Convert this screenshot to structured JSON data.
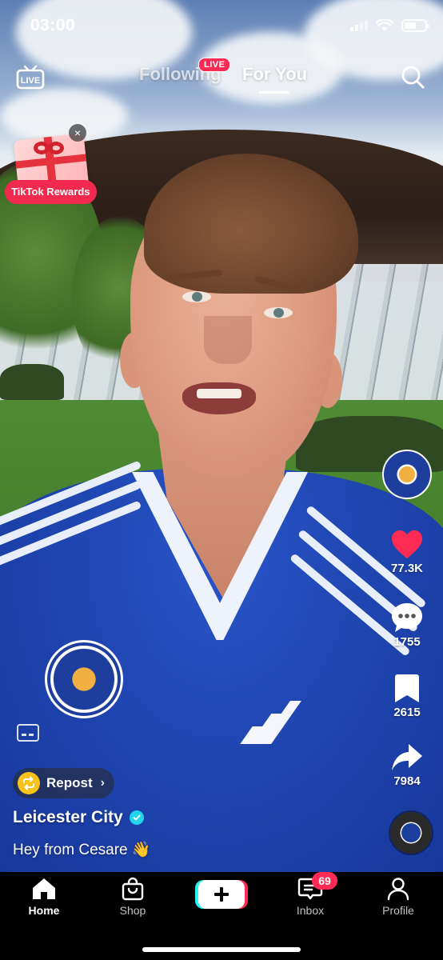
{
  "status_bar": {
    "time": "03:00"
  },
  "top_nav": {
    "tabs": [
      {
        "label": "Following",
        "active": false
      },
      {
        "label": "For You",
        "active": true
      }
    ],
    "live_badge": "LIVE",
    "live_icon_label": "LIVE"
  },
  "rewards": {
    "label": "TikTok Rewards",
    "close_glyph": "×"
  },
  "actions": {
    "likes": "77.3K",
    "comments": "1755",
    "saves": "2615",
    "shares": "7984"
  },
  "post": {
    "repost_label": "Repost",
    "author": "Leicester City",
    "caption": "Hey from Cesare 👋"
  },
  "tab_bar": {
    "items": [
      {
        "label": "Home",
        "active": true
      },
      {
        "label": "Shop",
        "active": false
      },
      {
        "label": "Inbox",
        "active": false
      },
      {
        "label": "Profile",
        "active": false
      }
    ],
    "inbox_badge": "69"
  },
  "colors": {
    "accent_red": "#fe2c55",
    "accent_cyan": "#25f4ee",
    "like_red": "#fe2c55",
    "club_blue": "#1d3e9c"
  },
  "icons": [
    "live-icon",
    "search-icon",
    "heart-icon",
    "comment-icon",
    "bookmark-icon",
    "share-icon",
    "captions-icon",
    "repost-icon",
    "verified-icon",
    "home-icon",
    "shop-icon",
    "create-icon",
    "inbox-icon",
    "profile-icon"
  ]
}
